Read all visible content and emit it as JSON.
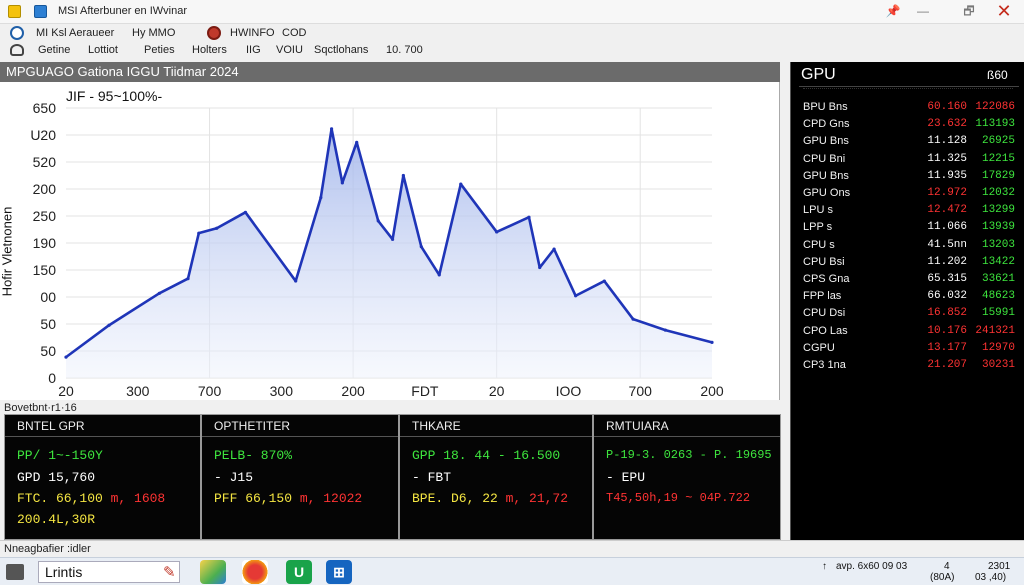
{
  "window": {
    "title": "MSI Afterbuner  en  IWvinar",
    "controls": [
      "📌",
      "—",
      "🗗",
      "✕"
    ]
  },
  "menu": {
    "items": [
      "MI Ksl Aeraueer",
      "Hy MMO",
      "HWINFO",
      "COD"
    ]
  },
  "toolbar": {
    "items": [
      "Getine",
      "Lottiot",
      "Peties",
      "Holters",
      "IIG",
      "VOIU",
      "Sqctlohans",
      "10. 700"
    ]
  },
  "chart": {
    "panel_title": "MPGUAGO Gationa IGGU Tiidmar 2024",
    "subtitle": "JIF - 95~100%-",
    "ylabel": "Hofir Vletnonen"
  },
  "chart_data": {
    "type": "area",
    "title": "MPGUAGO Gationa IGGU Tiidmar 2024",
    "subtitle": "JIF - 95~100%-",
    "ylabel": "Hofir Vletnonen",
    "xlabel": "",
    "ytick_labels": [
      "650",
      "U20",
      "520",
      "200",
      "250",
      "190",
      "150",
      "00",
      "50",
      "50",
      "0"
    ],
    "xtick_labels": [
      "20",
      "300",
      "700",
      "300",
      "200",
      "FDT",
      "20",
      "IOO",
      "700",
      "200"
    ],
    "ylim": [
      0,
      11
    ],
    "grid": true,
    "color": "#1f35b8",
    "x": [
      0,
      0.6,
      1.3,
      1.7,
      1.85,
      2.1,
      2.5,
      3.2,
      3.55,
      3.7,
      3.85,
      4.05,
      4.35,
      4.55,
      4.7,
      4.95,
      5.2,
      5.5,
      6.0,
      6.45,
      6.6,
      6.8,
      7.1,
      7.5,
      7.9,
      8.35,
      9.0
    ],
    "y": [
      0.85,
      2.15,
      3.45,
      4.05,
      5.9,
      6.1,
      6.75,
      3.95,
      7.35,
      10.15,
      7.95,
      9.6,
      6.4,
      5.65,
      8.25,
      5.35,
      4.2,
      7.9,
      5.95,
      6.55,
      4.5,
      5.25,
      3.35,
      3.95,
      2.4,
      1.95,
      1.45
    ]
  },
  "section_label": "Bovetbnt·r1·16",
  "panels": [
    {
      "title": "BNTEL GPR",
      "lines": [
        {
          "text": "PP/ 1~-150Y",
          "color": "#3ee63e"
        },
        {
          "text": "GPD 15,760",
          "color": "#ffffff"
        },
        {
          "text": "FTC. 66,100 ",
          "color": "#f5e642",
          "extra": "m, 1608",
          "extra_color": "#ff3333"
        },
        {
          "text": "200.4L,30R",
          "color": "#f5e642"
        }
      ]
    },
    {
      "title": "OPTHETITER",
      "lines": [
        {
          "text": "PELB- 870%",
          "color": "#3ee63e"
        },
        {
          "text": "- J15",
          "color": "#ffffff"
        },
        {
          "text": "PFF 66,150 ",
          "color": "#f5e642",
          "extra": "m, 12022",
          "extra_color": "#ff3333"
        }
      ]
    },
    {
      "title": "THKARE",
      "lines": [
        {
          "text": "GPP 18. 44 - 16.500",
          "color": "#3ee63e"
        },
        {
          "text": "- FBT",
          "color": "#ffffff"
        },
        {
          "text": "BPE. D6, 22 ",
          "color": "#f5e642",
          "extra": "m, 21,72",
          "extra_color": "#ff3333"
        }
      ]
    },
    {
      "title": "RMTUIARA",
      "lines": [
        {
          "text": "P-19-3. 0263 - P. 19695",
          "color": "#3ee63e"
        },
        {
          "text": "- EPU",
          "color": "#ffffff"
        },
        {
          "text": "T45,50h,19 ~ 04P.722",
          "color": "#ff3333"
        }
      ]
    }
  ],
  "gpu_panel": {
    "title": "GPU",
    "value": "ß60",
    "rows": [
      {
        "label": "BPU Bns",
        "v1": "60.160",
        "v2": "122086",
        "c1": "#ff3333",
        "c2": "#ff3333"
      },
      {
        "label": "CPD Gns",
        "v1": "23.632",
        "v2": "113193",
        "c1": "#ff3333",
        "c2": "#3ee63e"
      },
      {
        "label": "GPU Bns",
        "v1": "11.128",
        "v2": "26925",
        "c1": "#ffffff",
        "c2": "#3ee63e"
      },
      {
        "label": "CPU Bni",
        "v1": "11.325",
        "v2": "12215",
        "c1": "#ffffff",
        "c2": "#3ee63e"
      },
      {
        "label": "GPU Bns",
        "v1": "11.935",
        "v2": "17829",
        "c1": "#ffffff",
        "c2": "#3ee63e"
      },
      {
        "label": "GPU Ons",
        "v1": "12.972",
        "v2": "12032",
        "c1": "#ff3333",
        "c2": "#3ee63e"
      },
      {
        "label": "LPU s",
        "v1": "12.472",
        "v2": "13299",
        "c1": "#ff3333",
        "c2": "#3ee63e"
      },
      {
        "label": "LPP s",
        "v1": "11.066",
        "v2": "13939",
        "c1": "#ffffff",
        "c2": "#3ee63e"
      },
      {
        "label": "CPU s",
        "v1": "41.5nn",
        "v2": "13203",
        "c1": "#ffffff",
        "c2": "#3ee63e"
      },
      {
        "label": "CPU Bsi",
        "v1": "11.202",
        "v2": "13422",
        "c1": "#ffffff",
        "c2": "#3ee63e"
      },
      {
        "label": "CPS Gna",
        "v1": "65.315",
        "v2": "33621",
        "c1": "#ffffff",
        "c2": "#3ee63e"
      },
      {
        "label": "FPP las",
        "v1": "66.032",
        "v2": "48623",
        "c1": "#ffffff",
        "c2": "#3ee63e"
      },
      {
        "label": "CPU Dsi",
        "v1": "16.852",
        "v2": "15991",
        "c1": "#ff3333",
        "c2": "#3ee63e"
      },
      {
        "label": "CPO Las",
        "v1": "10.176",
        "v2": "241321",
        "c1": "#ff3333",
        "c2": "#ff3333"
      },
      {
        "label": "CGPU",
        "v1": "13.177",
        "v2": "12970",
        "c1": "#ff3333",
        "c2": "#ff3333"
      },
      {
        "label": "CP3 1na",
        "v1": "21.207",
        "v2": "30231",
        "c1": "#ff3333",
        "c2": "#ff3333"
      }
    ]
  },
  "status": {
    "text": "Nneagbafier  :idler"
  },
  "taskbar": {
    "search_text": "Lrintis",
    "tray": [
      "↑",
      "avp. 6x60 09 03",
      "4",
      "2301",
      "(80A)",
      "03 ,40)"
    ]
  }
}
